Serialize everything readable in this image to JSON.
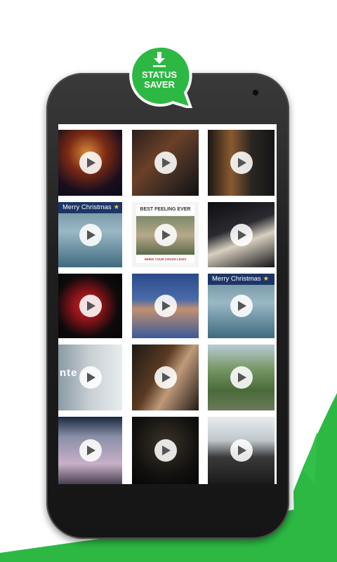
{
  "colors": {
    "brand_green": "#2db843",
    "phone_body": "#1f1f1f"
  },
  "badge": {
    "line1": "STATUS",
    "line2": "SAVER",
    "icon": "download-icon"
  },
  "videos": [
    {
      "id": "video-1"
    },
    {
      "id": "video-2"
    },
    {
      "id": "video-3"
    },
    {
      "id": "video-4",
      "banner": "Merry Christmas"
    },
    {
      "id": "video-5",
      "heading": "BEST FEELING EVER",
      "caption": "WHEN YOUR CRUSH LIKES"
    },
    {
      "id": "video-6"
    },
    {
      "id": "video-7"
    },
    {
      "id": "video-8"
    },
    {
      "id": "video-9",
      "banner": "Merry Christmas"
    },
    {
      "id": "video-10",
      "overlay": "nte"
    },
    {
      "id": "video-11"
    },
    {
      "id": "video-12"
    },
    {
      "id": "video-13"
    },
    {
      "id": "video-14"
    },
    {
      "id": "video-15"
    }
  ]
}
